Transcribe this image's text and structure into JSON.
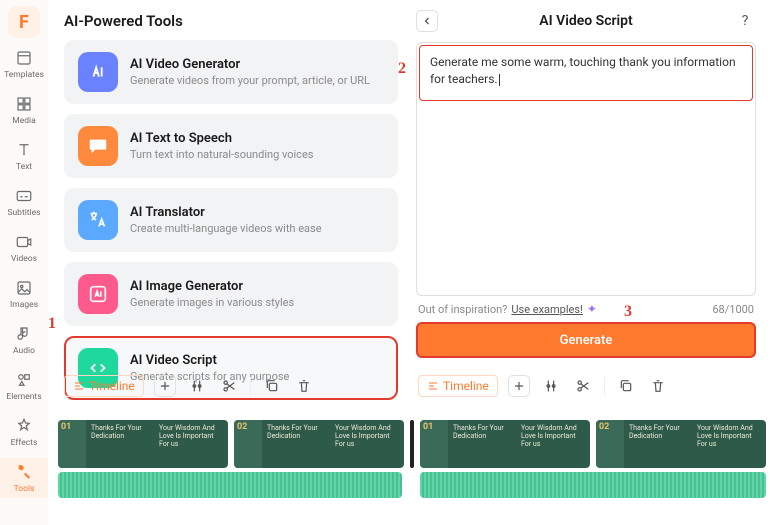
{
  "sidebar": {
    "logo": "F",
    "items": [
      {
        "label": "Templates"
      },
      {
        "label": "Media"
      },
      {
        "label": "Text"
      },
      {
        "label": "Subtitles"
      },
      {
        "label": "Videos"
      },
      {
        "label": "Images"
      },
      {
        "label": "Audio"
      },
      {
        "label": "Elements"
      },
      {
        "label": "Effects"
      },
      {
        "label": "Tools"
      }
    ]
  },
  "tools": {
    "title": "AI-Powered Tools",
    "items": [
      {
        "name": "AI Video Generator",
        "desc": "Generate videos from your prompt, article, or URL"
      },
      {
        "name": "AI Text to Speech",
        "desc": "Turn text into natural-sounding voices"
      },
      {
        "name": "AI Translator",
        "desc": "Create multi-language videos with ease"
      },
      {
        "name": "AI Image Generator",
        "desc": "Generate images in various styles"
      },
      {
        "name": "AI Video Script",
        "desc": "Generate scripts for any purpose"
      }
    ]
  },
  "script": {
    "title": "AI Video Script",
    "prompt_text": "Generate me some warm, touching thank you information for teachers.",
    "inspire_label": "Out of inspiration?",
    "examples_label": "Use examples!",
    "counter": "68/1000",
    "generate_label": "Generate",
    "help": "?"
  },
  "timeline": {
    "chip_label": "Timeline",
    "clips": [
      {
        "num": "01",
        "thanks": "Thanks For Your Dedication",
        "wisdom": "Your Wisdom And Love Is Important For us"
      },
      {
        "num": "02",
        "thanks": "Thanks For Your Dedication",
        "wisdom": "Your Wisdom And Love Is Important For us"
      },
      {
        "num": "01",
        "thanks": "Thanks For Your Dedication",
        "wisdom": "Your Wisdom And Love Is Important For us"
      },
      {
        "num": "02",
        "thanks": "Thanks For Your Dedication",
        "wisdom": "Your Wisdom And Love Is Important For us"
      }
    ]
  },
  "annotations": {
    "a1": "1",
    "a2": "2",
    "a3": "3"
  }
}
